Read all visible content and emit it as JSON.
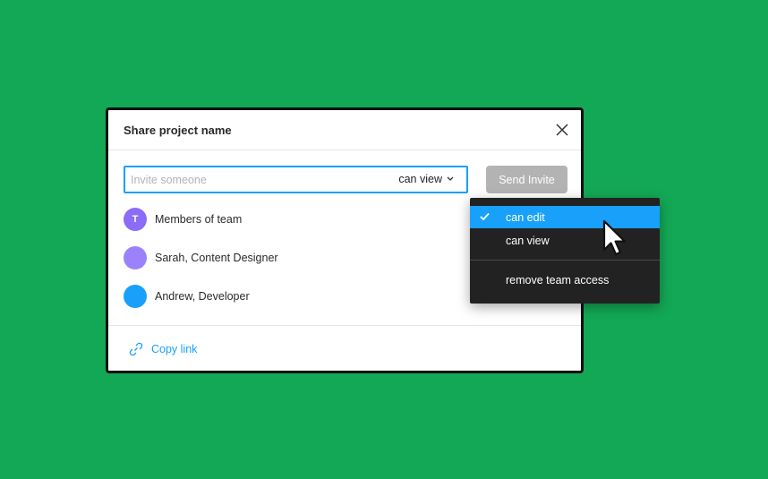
{
  "dialog": {
    "title": "Share project name"
  },
  "invite": {
    "placeholder": "Invite someone",
    "value": "",
    "permission": "can view",
    "send_label": "Send Invite"
  },
  "members": [
    {
      "initial": "T",
      "name": "Members of team",
      "color": "#8c6cf6"
    },
    {
      "initial": "",
      "name": "Sarah, Content Designer",
      "color": "#9b82fb"
    },
    {
      "initial": "",
      "name": "Andrew, Developer",
      "color": "#18a0fb"
    }
  ],
  "footer": {
    "copy_link_label": "Copy link"
  },
  "permission_menu": {
    "items": [
      {
        "label": "can edit",
        "selected": true
      },
      {
        "label": "can view",
        "selected": false
      },
      {
        "label": "remove team access",
        "selected": false
      }
    ]
  },
  "colors": {
    "background": "#13a855",
    "accent": "#18a0fb",
    "disabled_button": "#b3b3b3",
    "menu_background": "#222222"
  },
  "icons": {
    "close": "close-icon",
    "dropdown_caret": "chevron-down-icon",
    "copy_link": "link-icon",
    "check": "check-icon",
    "cursor": "mouse-pointer-icon"
  }
}
